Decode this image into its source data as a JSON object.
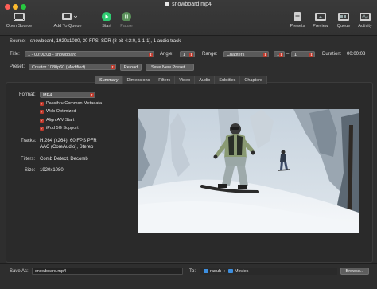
{
  "window": {
    "title": "snowboard.mp4"
  },
  "toolbar": {
    "open_source": "Open Source",
    "add_to_queue": "Add To Queue",
    "start": "Start",
    "pause": "Pause",
    "presets": "Presets",
    "preview": "Preview",
    "queue": "Queue",
    "activity": "Activity"
  },
  "source": {
    "label": "Source:",
    "value": "snowboard, 1920x1080, 30 FPS, SDR (8-bit 4:2:0, 1-1-1), 1 audio track"
  },
  "title_row": {
    "label": "Title:",
    "title_value": "1 - 00:00:08 - snowboard",
    "angle_label": "Angle:",
    "angle_value": "1",
    "range_label": "Range:",
    "range_type": "Chapters",
    "range_start": "1",
    "range_dash": "–",
    "range_end": "1",
    "duration_label": "Duration:",
    "duration_value": "00:00:08"
  },
  "preset_row": {
    "label": "Preset:",
    "value": "Creator 1080p60 (Modified)",
    "reload": "Reload",
    "save_new": "Save New Preset..."
  },
  "tabs": [
    "Summary",
    "Dimensions",
    "Filters",
    "Video",
    "Audio",
    "Subtitles",
    "Chapters"
  ],
  "summary": {
    "format_label": "Format:",
    "format_value": "MP4",
    "checkboxes": [
      "Passthru Common Metadata",
      "Web Optimized",
      "Align A/V Start",
      "iPod 5G Support"
    ],
    "tracks_label": "Tracks:",
    "tracks_line1": "H.264 (x264), 60 FPS PFR",
    "tracks_line2": "AAC (CoreAudio), Stereo",
    "filters_label": "Filters:",
    "filters_value": "Comb Detect, Decomb",
    "size_label": "Size:",
    "size_value": "1920x1080"
  },
  "bottom": {
    "save_as_label": "Save As:",
    "save_as_value": "snowboard.mp4",
    "to_label": "To:",
    "path_user": "raduh",
    "path_sep": "›",
    "path_folder": "Movies",
    "browse": "Browse..."
  },
  "colors": {
    "accent": "#c0392b",
    "start_green": "#2ecc71"
  }
}
